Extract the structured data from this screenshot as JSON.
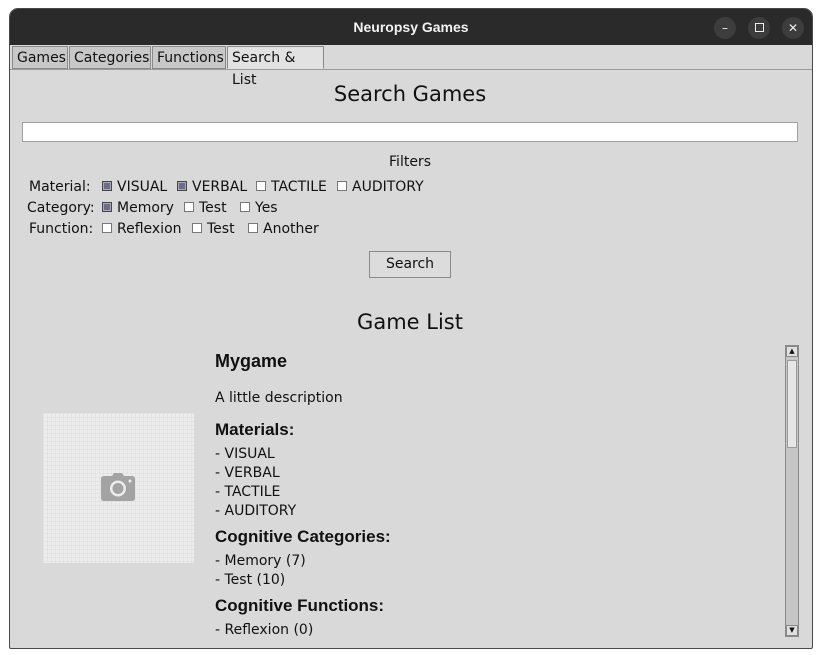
{
  "window": {
    "title": "Neuropsy Games",
    "controls": {
      "minimize": "–",
      "close": "✕"
    }
  },
  "tabs": [
    {
      "label": "Games"
    },
    {
      "label": "Categories"
    },
    {
      "label": "Functions"
    },
    {
      "label": "Search & List",
      "active": true
    }
  ],
  "search": {
    "heading": "Search Games",
    "query": "",
    "filters_label": "Filters",
    "button_label": "Search"
  },
  "filters": {
    "material": {
      "label": "Material:",
      "options": [
        {
          "label": "VISUAL",
          "checked": true
        },
        {
          "label": "VERBAL",
          "checked": true
        },
        {
          "label": "TACTILE",
          "checked": false
        },
        {
          "label": "AUDITORY",
          "checked": false
        }
      ]
    },
    "category": {
      "label": "Category:",
      "options": [
        {
          "label": "Memory",
          "checked": true
        },
        {
          "label": "Test",
          "checked": false
        },
        {
          "label": "Yes",
          "checked": false
        }
      ]
    },
    "function": {
      "label": "Function:",
      "options": [
        {
          "label": "Reflexion",
          "checked": false
        },
        {
          "label": "Test",
          "checked": false
        },
        {
          "label": "Another",
          "checked": false
        }
      ]
    }
  },
  "game_list": {
    "heading": "Game List",
    "items": [
      {
        "title": "Mygame",
        "description": "A little description",
        "materials_heading": "Materials:",
        "materials": [
          "- VISUAL",
          "- VERBAL",
          "- TACTILE",
          "- AUDITORY"
        ],
        "categories_heading": "Cognitive Categories:",
        "categories": [
          "- Memory (7)",
          "- Test (10)"
        ],
        "functions_heading": "Cognitive Functions:",
        "functions": [
          "- Reflexion (0)"
        ]
      }
    ]
  },
  "icons": {
    "image_placeholder": "camera-icon"
  },
  "colors": {
    "titlebar": "#2a2a2a",
    "background": "#d9d9d9",
    "checked": "#6a6f86"
  }
}
